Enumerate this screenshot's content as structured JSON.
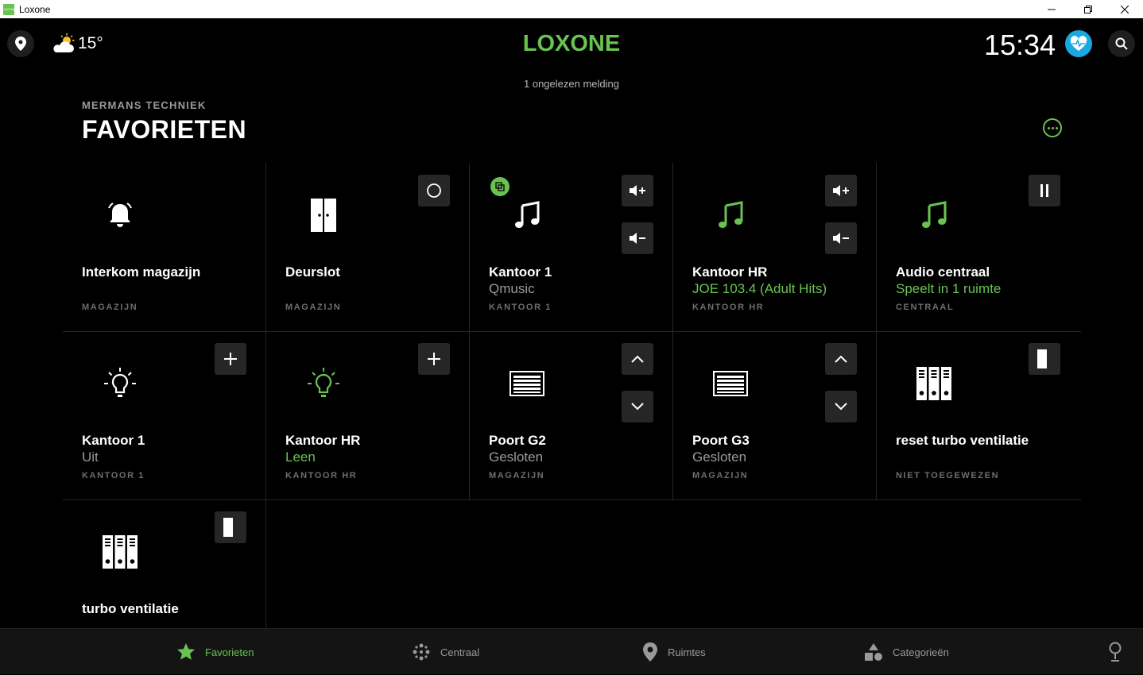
{
  "window": {
    "title": "Loxone",
    "icon_label": "LOXONE"
  },
  "header": {
    "temperature": "15°",
    "brand": "LOXONE",
    "time": "15:34",
    "notification": "1 ongelezen melding"
  },
  "page": {
    "subtitle": "MERMANS TECHNIEK",
    "title": "FAVORIETEN"
  },
  "tiles": [
    {
      "name": "Interkom magazijn",
      "state": "",
      "room": "MAGAZIJN"
    },
    {
      "name": "Deurslot",
      "state": "",
      "room": "MAGAZIJN"
    },
    {
      "name": "Kantoor 1",
      "state": "Qmusic",
      "room": "KANTOOR 1"
    },
    {
      "name": "Kantoor HR",
      "state": "JOE 103.4 (Adult Hits)",
      "room": "KANTOOR HR"
    },
    {
      "name": "Audio centraal",
      "state": "Speelt in 1 ruimte",
      "room": "CENTRAAL"
    },
    {
      "name": "Kantoor 1",
      "state": "Uit",
      "room": "KANTOOR 1"
    },
    {
      "name": "Kantoor HR",
      "state": "Leen",
      "room": "KANTOOR HR"
    },
    {
      "name": "Poort G2",
      "state": "Gesloten",
      "room": "MAGAZIJN"
    },
    {
      "name": "Poort G3",
      "state": "Gesloten",
      "room": "MAGAZIJN"
    },
    {
      "name": "reset turbo ventilatie",
      "state": "",
      "room": "NIET TOEGEWEZEN"
    },
    {
      "name": "turbo ventilatie",
      "state": "",
      "room": ""
    }
  ],
  "nav": {
    "favorites": "Favorieten",
    "central": "Centraal",
    "rooms": "Ruimtes",
    "categories": "Categorieën"
  },
  "colors": {
    "accent": "#69c350",
    "background": "#000000",
    "tile_button": "#262626"
  }
}
